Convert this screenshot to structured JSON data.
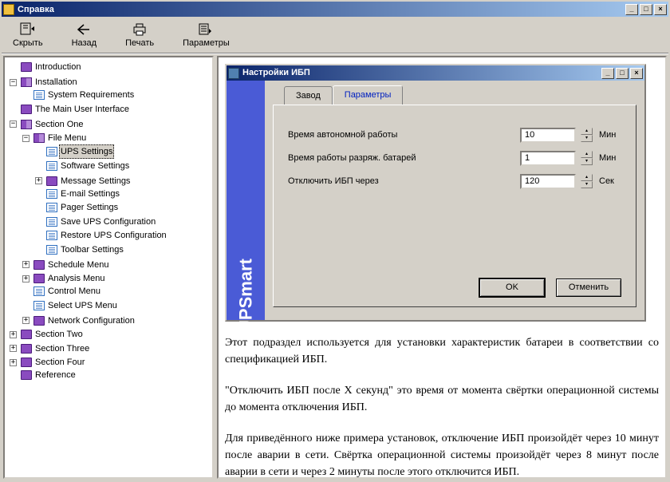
{
  "window": {
    "title": "Справка"
  },
  "window_controls": {
    "min": "_",
    "max": "□",
    "close": "×"
  },
  "toolbar": {
    "hide": "Скрыть",
    "back": "Назад",
    "print": "Печать",
    "options": "Параметры"
  },
  "tree": {
    "introduction": "Introduction",
    "installation": "Installation",
    "system_requirements": "System Requirements",
    "main_ui": "The Main User Interface",
    "section_one": "Section One",
    "file_menu": "File Menu",
    "ups_settings": "UPS Settings",
    "software_settings": "Software Settings",
    "message_settings": "Message Settings",
    "email_settings": "E-mail Settings",
    "pager_settings": "Pager Settings",
    "save_ups_cfg": "Save UPS Configuration",
    "restore_ups_cfg": "Restore UPS Configuration",
    "toolbar_settings": "Toolbar Settings",
    "schedule_menu": "Schedule Menu",
    "analysis_menu": "Analysis Menu",
    "control_menu": "Control Menu",
    "select_ups_menu": "Select UPS Menu",
    "network_cfg": "Network Configuration",
    "section_two": "Section Two",
    "section_three": "Section Three",
    "section_four": "Section Four",
    "reference": "Reference"
  },
  "dialog": {
    "title": "Настройки ИБП",
    "sideband": "UPSmart",
    "tab_factory": "Завод",
    "tab_params": "Параметры",
    "row1_label": "Время автономной работы",
    "row1_value": "10",
    "row1_unit": "Мин",
    "row2_label": "Время работы разряж. батарей",
    "row2_value": "1",
    "row2_unit": "Мин",
    "row3_label": "Отключить ИБП через",
    "row3_value": "120",
    "row3_unit": "Сек",
    "ok": "OK",
    "cancel": "Отменить"
  },
  "content": {
    "p1": "Этот подраздел используется для установки характеристик батареи в соответствии со спецификацией ИБП.",
    "p2": "\"Отключить ИБП после X секунд\" это время от момента свёртки операционной системы до момента отключения ИБП.",
    "p3": "Для приведённого ниже примера установок, отключение ИБП произойдёт через 10 минут после аварии в сети. Свёртка операционной системы произойдёт через 8 минут после аварии в сети и через 2 минуты после этого отключится ИБП."
  }
}
